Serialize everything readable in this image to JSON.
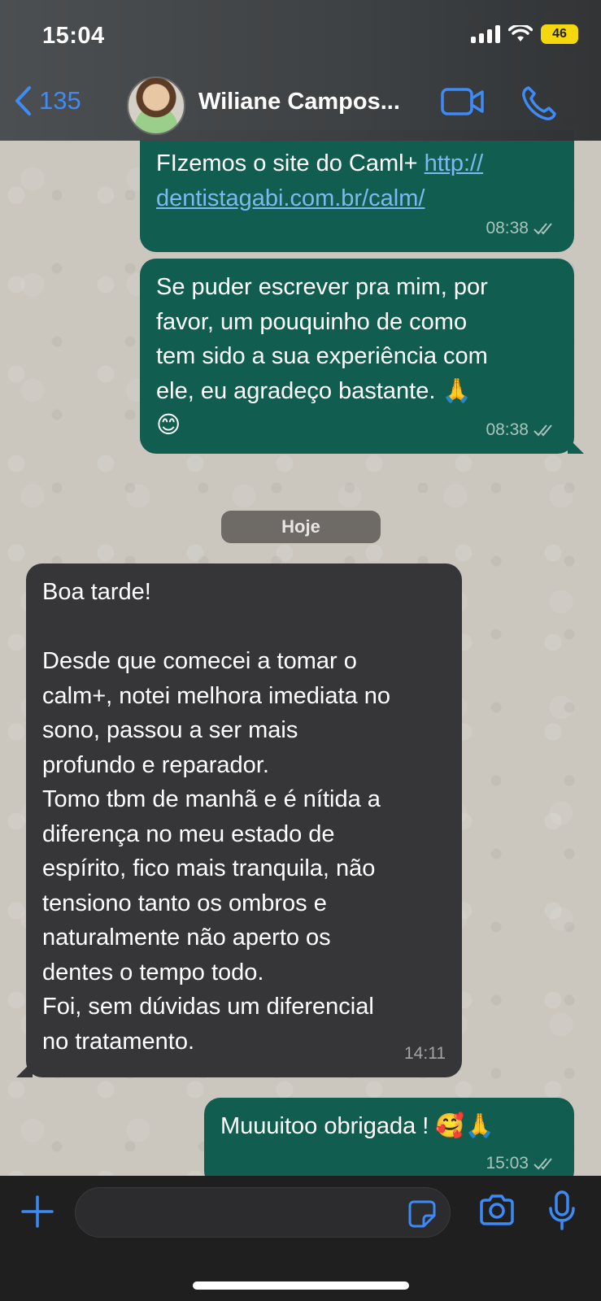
{
  "status_bar": {
    "time": "15:04",
    "battery": "46"
  },
  "header": {
    "back_count": "135",
    "contact_name": "Wiliane Campos..."
  },
  "messages": [
    {
      "direction": "out",
      "text": "FIzemos o site do Caml+ ",
      "link": "http://dentistagabi.com.br/calm/",
      "link_line1": "http://",
      "link_line2": "dentistagabi.com.br/calm/",
      "time": "08:38"
    },
    {
      "direction": "out",
      "text": "Se puder escrever pra mim, por\nfavor, um pouquinho de como\ntem sido a sua experiência com\nele, eu agradeço bastante. 🙏\n😊",
      "time": "08:38"
    },
    {
      "direction": "in",
      "text": "Boa tarde!\n\nDesde que comecei a tomar o\ncalm+, notei melhora imediata no\nsono, passou a ser mais\nprofundo e reparador.\nTomo tbm de manhã e é nítida a\ndiferença no meu estado de\nespírito, fico mais tranquila, não\ntensiono tanto os ombros e\nnaturalmente não aperto os\ndentes o tempo todo.\nFoi, sem dúvidas um diferencial\nno tratamento.",
      "time": "14:11"
    },
    {
      "direction": "out",
      "text": "Muuuitoo obrigada ! 🥰🙏",
      "time": "15:03"
    }
  ],
  "date_separator": "Hoje",
  "composer": {
    "placeholder": ""
  },
  "colors": {
    "accent": "#3d8af7",
    "outgoing_bubble": "#115e50",
    "incoming_bubble": "#363638",
    "battery": "#f5d90a"
  },
  "icons": {
    "back": "chevron-left-icon",
    "video": "video-camera-icon",
    "call": "phone-icon",
    "attach": "plus-icon",
    "sticker": "sticker-icon",
    "camera": "camera-icon",
    "mic": "microphone-icon",
    "read_receipt": "double-check-icon"
  }
}
